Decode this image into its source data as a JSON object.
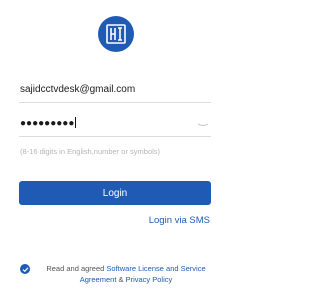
{
  "logo": {
    "icon": "hik-connect-logo-icon",
    "color": "#1f5bb5"
  },
  "login_form": {
    "email_value": "sajidcctvdesk@gmail.com",
    "password_masked": "●●●●●●●●●",
    "password_hint": "(8-16 digits in English,number or symbols)",
    "login_button": "Login",
    "sms_link": "Login via SMS"
  },
  "agreement": {
    "checked": true,
    "prefix": "Read and agreed ",
    "license_link": "Software License and Service Agreement",
    "ampersand": " & ",
    "privacy_link": "Privacy Policy"
  },
  "colors": {
    "accent": "#1f5bb5",
    "hint": "#b5b5b5",
    "divider": "#dcdcdc"
  }
}
